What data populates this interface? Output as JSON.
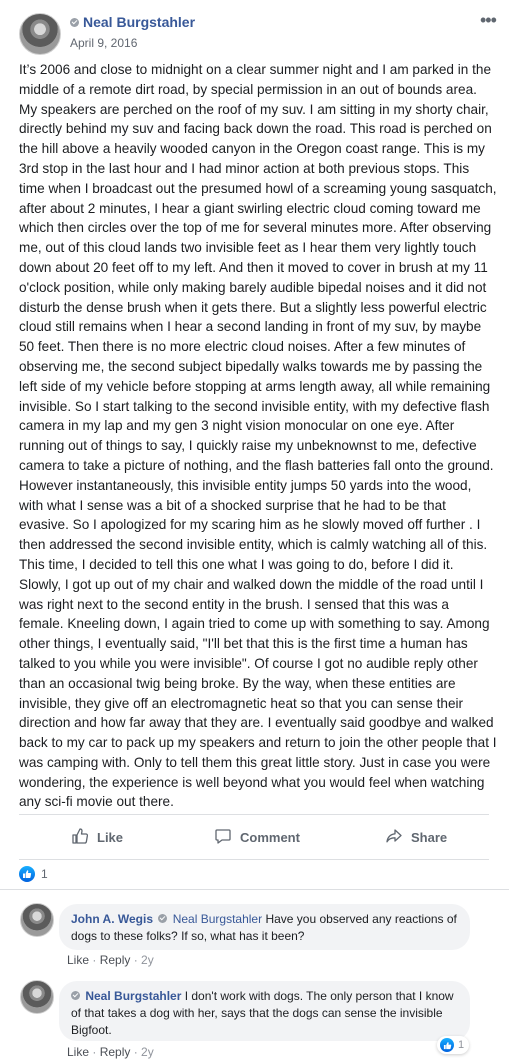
{
  "post": {
    "author": "Neal Burgstahler",
    "date": "April 9, 2016",
    "body": "It’s 2006 and close to midnight on a clear summer night and I am parked in the middle of a remote dirt road, by special permission in an out of bounds area. My speakers are perched on the roof of my suv. I am sitting in my shorty chair, directly behind my suv and facing back down the road. This road is perched on the hill above a heavily wooded canyon in the Oregon coast range. This is my 3rd stop in the last hour and I had minor action at both previous stops. This time when I broadcast out the presumed howl of a screaming young sasquatch, after about 2 minutes, I hear a giant swirling electric cloud coming toward me which then circles over the top of me for several minutes more. After observing me, out of this cloud lands two invisible feet as I hear them very lightly touch down about 20 feet off to my left. And then it moved to cover in brush at my 11 o'clock position, while only making barely audible bipedal noises and it did not disturb the dense brush when it gets there. But a slightly less powerful electric cloud still remains when I hear a second landing in front of my suv, by maybe 50 feet. Then there is no more electric cloud noises. After a few minutes of observing me, the second subject bipedally walks towards me by passing the left side of my vehicle before stopping at arms length away, all while remaining invisible. So I start talking to the second invisible entity, with my defective flash camera in my lap and my gen 3 night vision monocular on one eye. After running out of things to say, I quickly raise my unbeknownst to me, defective camera to take a picture of nothing, and the flash batteries fall onto the ground. However instantaneously, this invisible entity jumps 50 yards into the wood, with what I sense was a bit of a shocked surprise that he had to be that evasive. So I apologized for my scaring him as he slowly moved off further . I then addressed the second invisible entity, which is calmly watching all of this. This time, I decided to tell this one what I was going to do, before I did it. Slowly, I got up out of my chair and walked down the middle of the road until I was right next to the second entity in the brush. I sensed that this was a female. Kneeling down, I again tried to come up with something to say. Among other things, I eventually said, \"I'll bet that this is the first time a human has talked to you while you were invisible\". Of course I got no audible reply other than an occasional twig being broke. By the way, when these entities are invisible, they give off an electromagnetic heat so that you can sense their direction and how far away that they are. I eventually said goodbye and walked back to my car to pack up my speakers and return to join the other people that I was camping with. Only to tell them this great little story. Just in case you were wondering, the experience is well beyond what you would feel when watching any sci-fi movie out there."
  },
  "actions": {
    "like": "Like",
    "comment": "Comment",
    "share": "Share"
  },
  "reactions": {
    "count": "1"
  },
  "comments": [
    {
      "author": "John A. Wegis",
      "mention": "Neal Burgstahler",
      "text": "Have you observed any reactions of dogs to these folks? If so, what has it been?",
      "like": "Like",
      "reply": "Reply",
      "age": "2y"
    },
    {
      "author": "Neal Burgstahler",
      "text": "I don't work with dogs. The only person that I know of that takes a dog with her, says that the dogs can sense the invisible Bigfoot.",
      "like": "Like",
      "reply": "Reply",
      "age": "2y",
      "reaction_count": "1"
    }
  ],
  "colors": {
    "link": "#385898",
    "meta": "#90949c",
    "reaction_blue": "#1877f2"
  },
  "icons": [
    "more-icon",
    "like-icon",
    "comment-icon",
    "share-icon",
    "verified-icon",
    "like-reaction-icon"
  ]
}
